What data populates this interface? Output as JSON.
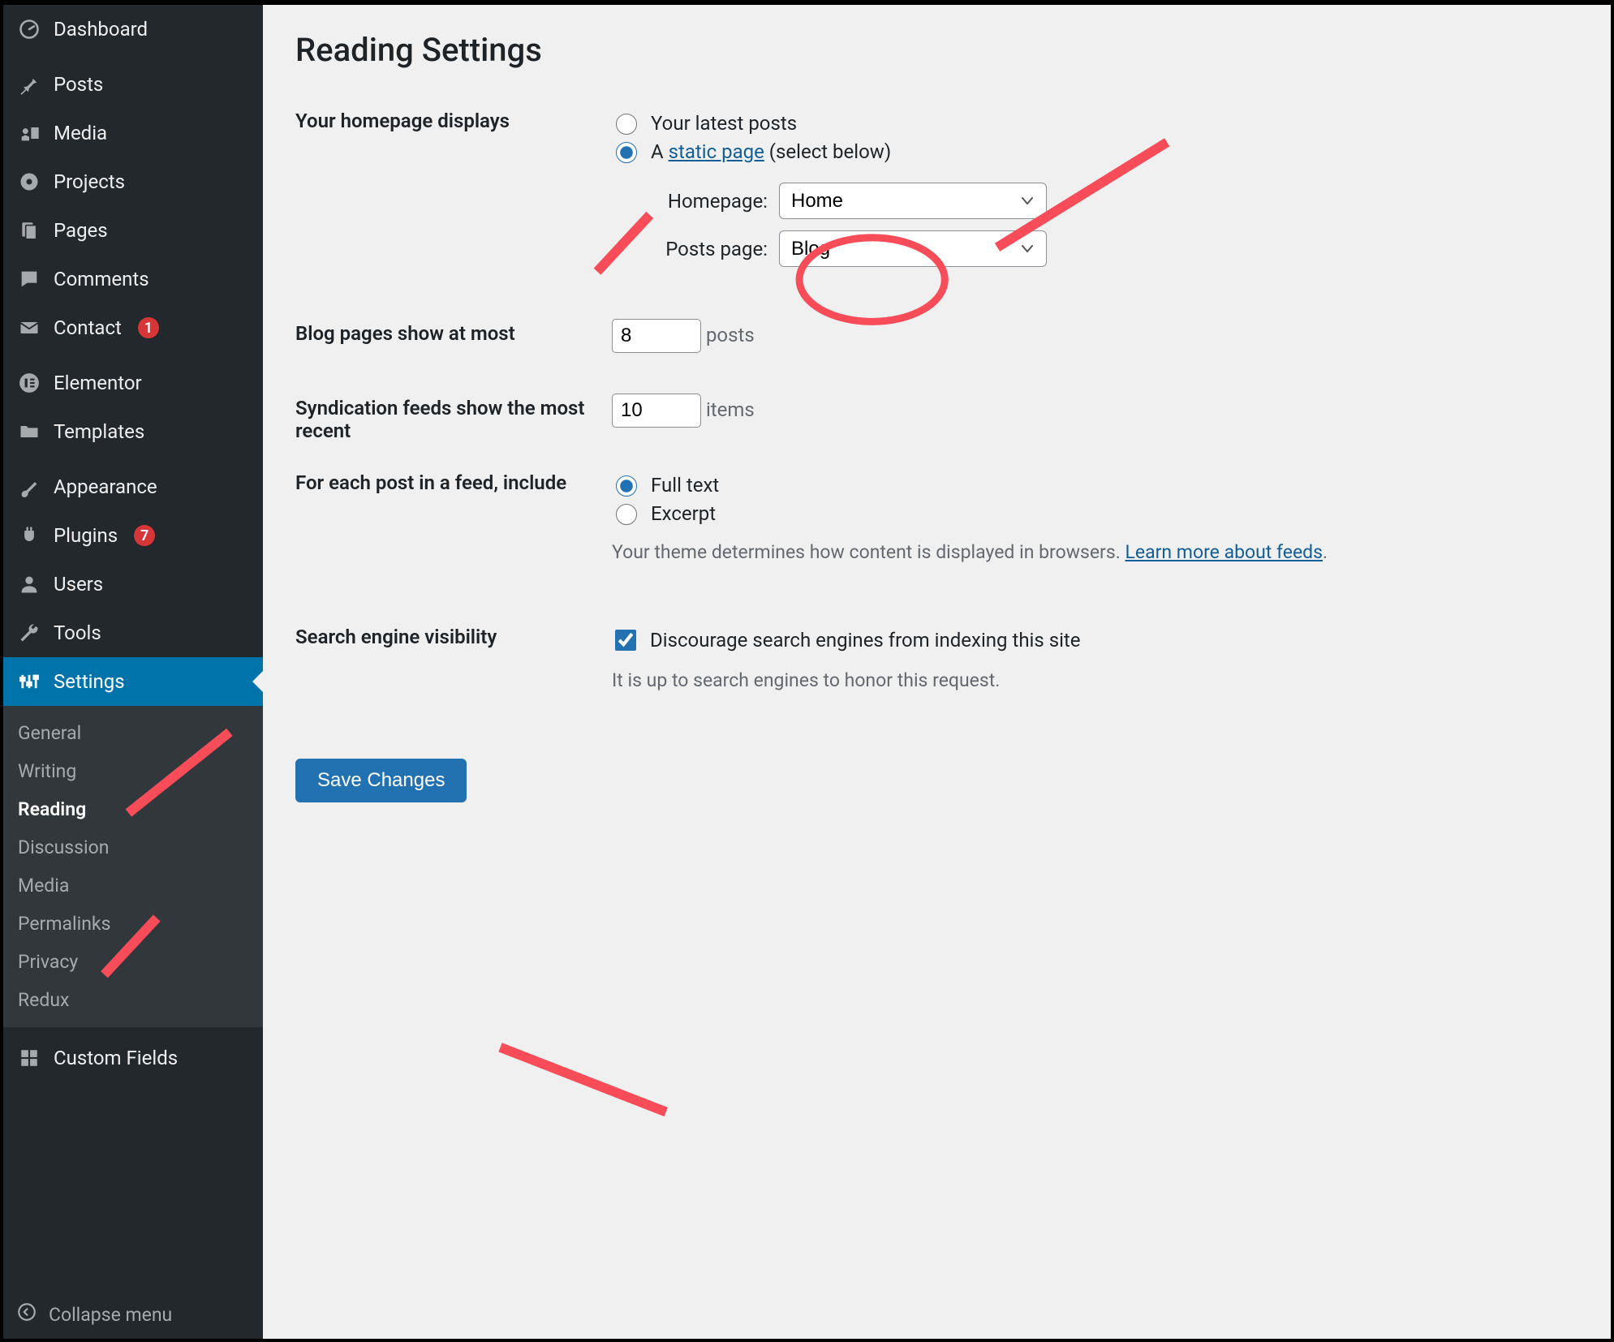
{
  "sidebar": {
    "items": [
      {
        "label": "Dashboard",
        "icon": "dashboard"
      },
      {
        "label": "Posts",
        "icon": "pin"
      },
      {
        "label": "Media",
        "icon": "media"
      },
      {
        "label": "Projects",
        "icon": "projects"
      },
      {
        "label": "Pages",
        "icon": "pages"
      },
      {
        "label": "Comments",
        "icon": "comments"
      },
      {
        "label": "Contact",
        "icon": "contact",
        "badge": "1"
      },
      {
        "label": "Elementor",
        "icon": "elementor"
      },
      {
        "label": "Templates",
        "icon": "templates"
      },
      {
        "label": "Appearance",
        "icon": "appearance"
      },
      {
        "label": "Plugins",
        "icon": "plugins",
        "badge": "7"
      },
      {
        "label": "Users",
        "icon": "users"
      },
      {
        "label": "Tools",
        "icon": "tools"
      },
      {
        "label": "Settings",
        "icon": "settings",
        "active": true
      },
      {
        "label": "Custom Fields",
        "icon": "customfields"
      }
    ],
    "settings_submenu": [
      "General",
      "Writing",
      "Reading",
      "Discussion",
      "Media",
      "Permalinks",
      "Privacy",
      "Redux"
    ],
    "settings_submenu_current": "Reading",
    "collapse_label": "Collapse menu"
  },
  "page": {
    "title": "Reading Settings",
    "homepage_displays_label": "Your homepage displays",
    "radio_latest": "Your latest posts",
    "radio_static_prefix": "A ",
    "radio_static_link": "static page",
    "radio_static_suffix": " (select below)",
    "homepage_label": "Homepage:",
    "homepage_value": "Home",
    "postspage_label": "Posts page:",
    "postspage_value": "Blog",
    "blog_pages_label": "Blog pages show at most",
    "blog_pages_value": "8",
    "blog_pages_suffix": "posts",
    "syndication_label": "Syndication feeds show the most recent",
    "syndication_value": "10",
    "syndication_suffix": "items",
    "feed_include_label": "For each post in a feed, include",
    "feed_full": "Full text",
    "feed_excerpt": "Excerpt",
    "feed_desc_prefix": "Your theme determines how content is displayed in browsers. ",
    "feed_desc_link": "Learn more about feeds",
    "feed_desc_suffix": ".",
    "search_visibility_label": "Search engine visibility",
    "search_checkbox": "Discourage search engines from indexing this site",
    "search_desc": "It is up to search engines to honor this request.",
    "save_button": "Save Changes"
  }
}
